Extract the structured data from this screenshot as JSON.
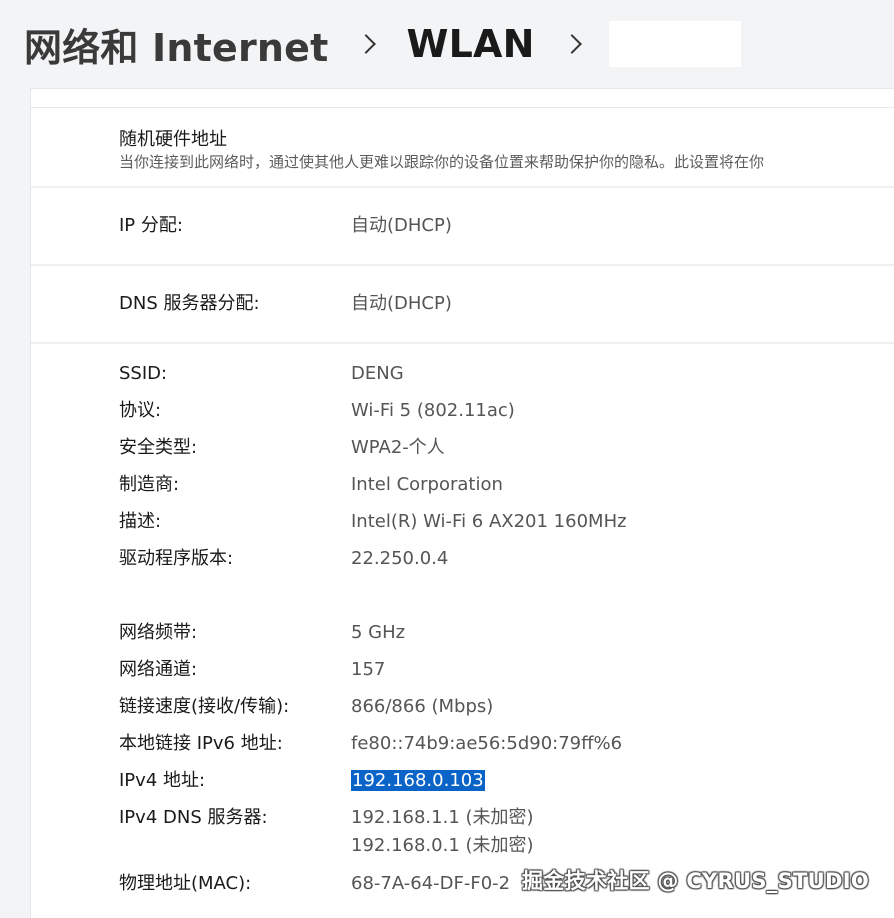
{
  "breadcrumb": {
    "first": "网络和 Internet",
    "second": "WLAN"
  },
  "mac": {
    "title": "随机硬件地址",
    "description": "当你连接到此网络时，通过使其他人更难以跟踪你的设备位置来帮助保护你的隐私。此设置将在你"
  },
  "ip_assignment": {
    "label": "IP 分配:",
    "value": "自动(DHCP)"
  },
  "dns_assignment": {
    "label": "DNS 服务器分配:",
    "value": "自动(DHCP)"
  },
  "properties": [
    {
      "label": "SSID:",
      "value": "DENG"
    },
    {
      "label": "协议:",
      "value": "Wi-Fi 5 (802.11ac)"
    },
    {
      "label": "安全类型:",
      "value": "WPA2-个人"
    },
    {
      "label": "制造商:",
      "value": "Intel Corporation"
    },
    {
      "label": "描述:",
      "value": "Intel(R) Wi-Fi 6 AX201 160MHz"
    },
    {
      "label": "驱动程序版本:",
      "value": "22.250.0.4"
    },
    {
      "label": "网络频带:",
      "value": "5 GHz"
    },
    {
      "label": "网络通道:",
      "value": "157"
    },
    {
      "label": "链接速度(接收/传输):",
      "value": "866/866 (Mbps)"
    },
    {
      "label": "本地链接 IPv6 地址:",
      "value": "fe80::74b9:ae56:5d90:79ff%6"
    },
    {
      "label": "IPv4 地址:",
      "value": "192.168.0.103"
    },
    {
      "label": "IPv4 DNS 服务器:",
      "value": "192.168.1.1 (未加密)",
      "value2": "192.168.0.1 (未加密)"
    },
    {
      "label": "物理地址(MAC):",
      "value": "68-7A-64-DF-F0-2"
    }
  ],
  "watermark": "掘金技术社区 @ CYRUS_STUDIO",
  "colors": {
    "selection": "#0a64c8",
    "background": "#f3f4f6"
  }
}
